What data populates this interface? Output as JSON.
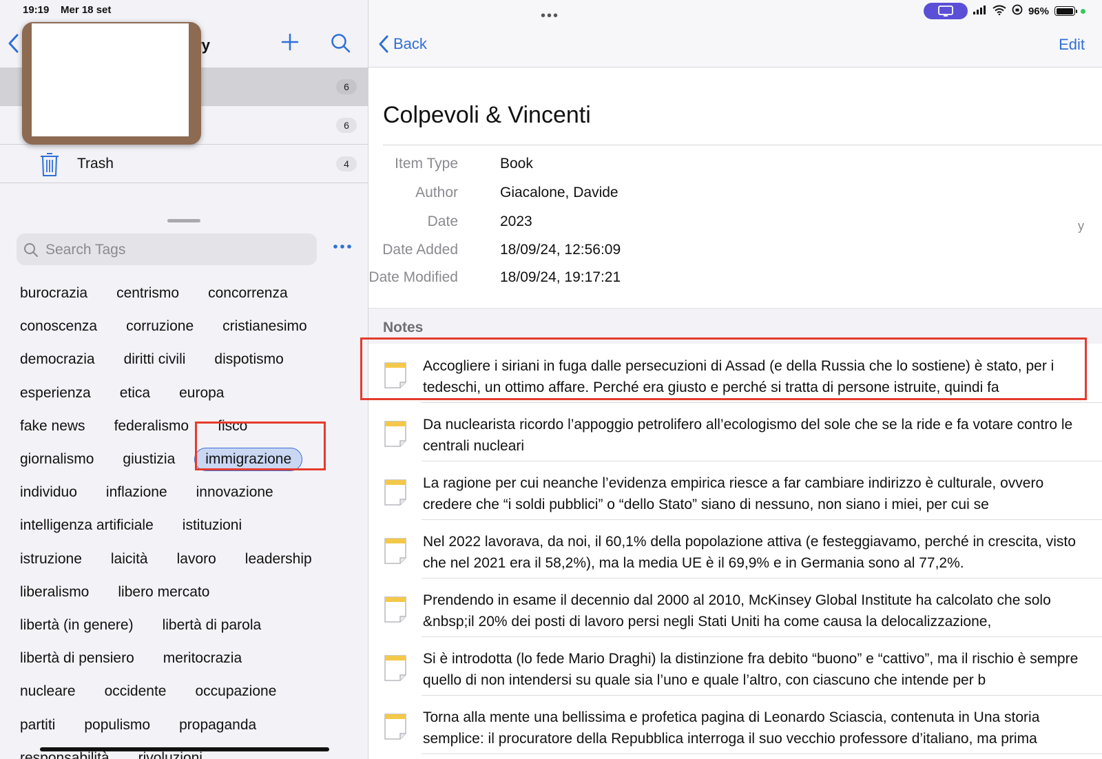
{
  "status_bar": {
    "time": "19:19",
    "date": "Mer 18 set",
    "battery_percent": "96%",
    "battery_level": 0.96
  },
  "left_panel": {
    "title_fragment": "ary",
    "library_rows": [
      {
        "label": "",
        "count": "6",
        "selected": true
      },
      {
        "label": "",
        "count": "6",
        "selected": false
      },
      {
        "label": "Trash",
        "count": "4",
        "selected": false
      }
    ],
    "tag_search_placeholder": "Search Tags",
    "tag_rows": [
      [
        "burocrazia",
        "centrismo",
        "concorrenza"
      ],
      [
        "conoscenza",
        "corruzione",
        "cristianesimo"
      ],
      [
        "democrazia",
        "diritti civili",
        "dispotismo"
      ],
      [
        "esperienza",
        "etica",
        "europa"
      ],
      [
        "fake news",
        "federalismo",
        "fisco"
      ],
      [
        "giornalismo",
        "giustizia",
        "immigrazione"
      ],
      [
        "individuo",
        "inflazione",
        "innovazione"
      ],
      [
        "intelligenza artificiale",
        "istituzioni"
      ],
      [
        "istruzione",
        "laicità",
        "lavoro",
        "leadership"
      ],
      [
        "liberalismo",
        "libero mercato"
      ],
      [
        "libertà (in genere)",
        "libertà di parola"
      ],
      [
        "libertà di pensiero",
        "meritocrazia"
      ],
      [
        "nucleare",
        "occidente",
        "occupazione"
      ],
      [
        "partiti",
        "populismo",
        "propaganda"
      ],
      [
        "responsabilità",
        "rivoluzioni"
      ]
    ],
    "selected_tag": "immigrazione"
  },
  "right_panel": {
    "back_label": "Back",
    "edit_label": "Edit",
    "title": "Colpevoli & Vincenti",
    "fields": [
      {
        "label": "Item Type",
        "value": "Book"
      },
      {
        "label": "Author",
        "value": "Giacalone, Davide"
      },
      {
        "label": "Date",
        "value": "2023"
      },
      {
        "label": "Date Added",
        "value": "18/09/24, 12:56:09"
      },
      {
        "label": "Date Modified",
        "value": "18/09/24, 19:17:21"
      }
    ],
    "date_side_marker": "y",
    "notes_header": "Notes",
    "notes": [
      "Accogliere i siriani in fuga dalle persecuzioni di Assad (e della Russia che lo sostiene) è stato, per i tedeschi, un ottimo affare. Perché era giusto e perché si tratta di persone istruite, quindi fa",
      "Da nuclearista ricordo l’appoggio petrolifero all’ecologismo del sole che se la ride e fa votare contro le centrali nucleari",
      "La ragione per cui neanche l’evidenza empirica riesce a far cambiare indirizzo è culturale, ovvero credere che “i soldi pubblici” o “dello Stato” siano di nessuno, non siano i miei, per cui se",
      "Nel 2022 lavorava, da noi, il 60,1% della popolazione attiva (e festeggiavamo, perché in crescita, visto che nel 2021 era il 58,2%), ma la media UE è il 69,9% e in Germania sono al 77,2%.",
      "Prendendo in esame il decennio dal 2000 al 2010, McKinsey Global Institute ha calcolato che solo &nbsp;il 20% dei posti di lavoro persi negli Stati Uniti ha come causa la delocalizzazione,",
      "Si è introdotta (lo fede Mario Draghi) la distinzione fra debito “buono” e “cattivo”, ma il rischio è sempre quello di non intendersi su quale sia l’uno e quale l’altro, con ciascuno che intende per b",
      "Torna alla mente una bellissima e profetica pagina di Leonardo Sciascia, contenuta in Una storia semplice: il procuratore della Repubblica interroga il suo vecchio professore d’italiano, ma prima"
    ]
  },
  "colors": {
    "accent": "#2f6fd6",
    "highlight_box": "#e53b2c",
    "selected_tag_bg": "#c9d7f3",
    "status_pill": "#5a4fd6"
  }
}
